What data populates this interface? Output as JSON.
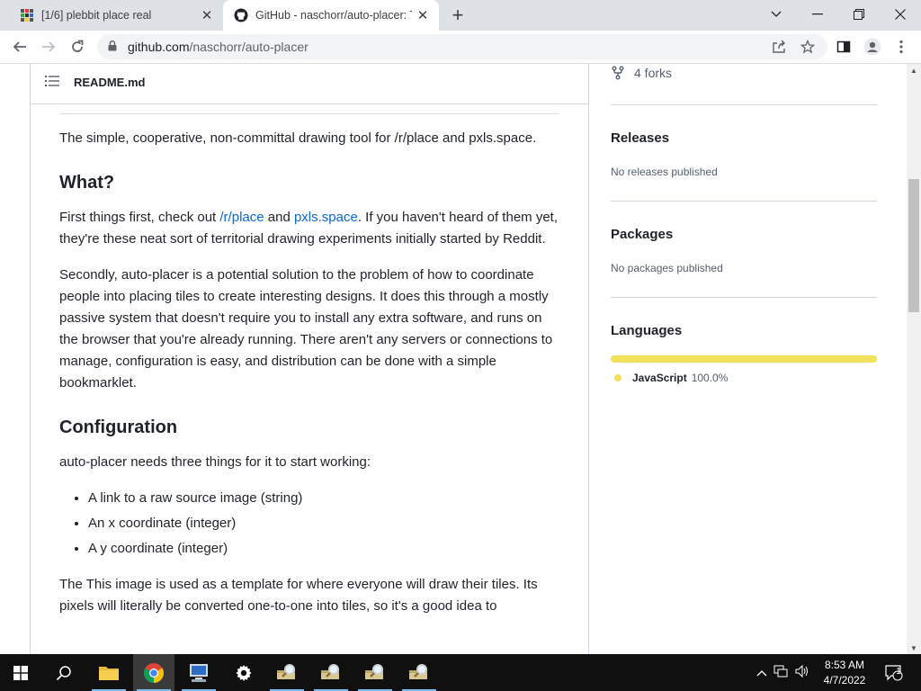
{
  "browser": {
    "tabs": [
      {
        "title": "[1/6] plebbit place real"
      },
      {
        "title": "GitHub - naschorr/auto-placer: Th"
      }
    ],
    "url_host": "github.com",
    "url_path": "/naschorr/auto-placer"
  },
  "readme": {
    "filename": "README.md",
    "intro": "The simple, cooperative, non-committal drawing tool for /r/place and pxls.space.",
    "what_heading": "What?",
    "what_p1_before": "First things first, check out ",
    "what_link1": "/r/place",
    "what_p1_mid": " and ",
    "what_link2": "pxls.space",
    "what_p1_after": ". If you haven't heard of them yet, they're these neat sort of territorial drawing experiments initially started by Reddit.",
    "what_p2": "Secondly, auto-placer is a potential solution to the problem of how to coordinate people into placing tiles to create interesting designs. It does this through a mostly passive system that doesn't require you to install any extra software, and runs on the browser that you're already running. There aren't any servers or connections to manage, configuration is easy, and distribution can be done with a simple bookmarklet.",
    "config_heading": "Configuration",
    "config_intro": "auto-placer needs three things for it to start working:",
    "config_items": [
      "A link to a raw source image (string)",
      "An x coordinate (integer)",
      "A y coordinate (integer)"
    ],
    "config_after": "The This image is used as a template for where everyone will draw their tiles. Its pixels will literally be converted one-to-one into tiles, so it's a good idea to"
  },
  "sidebar": {
    "forks": "4 forks",
    "releases_heading": "Releases",
    "releases_text": "No releases published",
    "packages_heading": "Packages",
    "packages_text": "No packages published",
    "languages_heading": "Languages",
    "language_name": "JavaScript",
    "language_percent": "100.0%",
    "language_color": "#f1e05a"
  },
  "taskbar": {
    "time": "8:53 AM",
    "date": "4/7/2022",
    "notification_count": "1"
  }
}
